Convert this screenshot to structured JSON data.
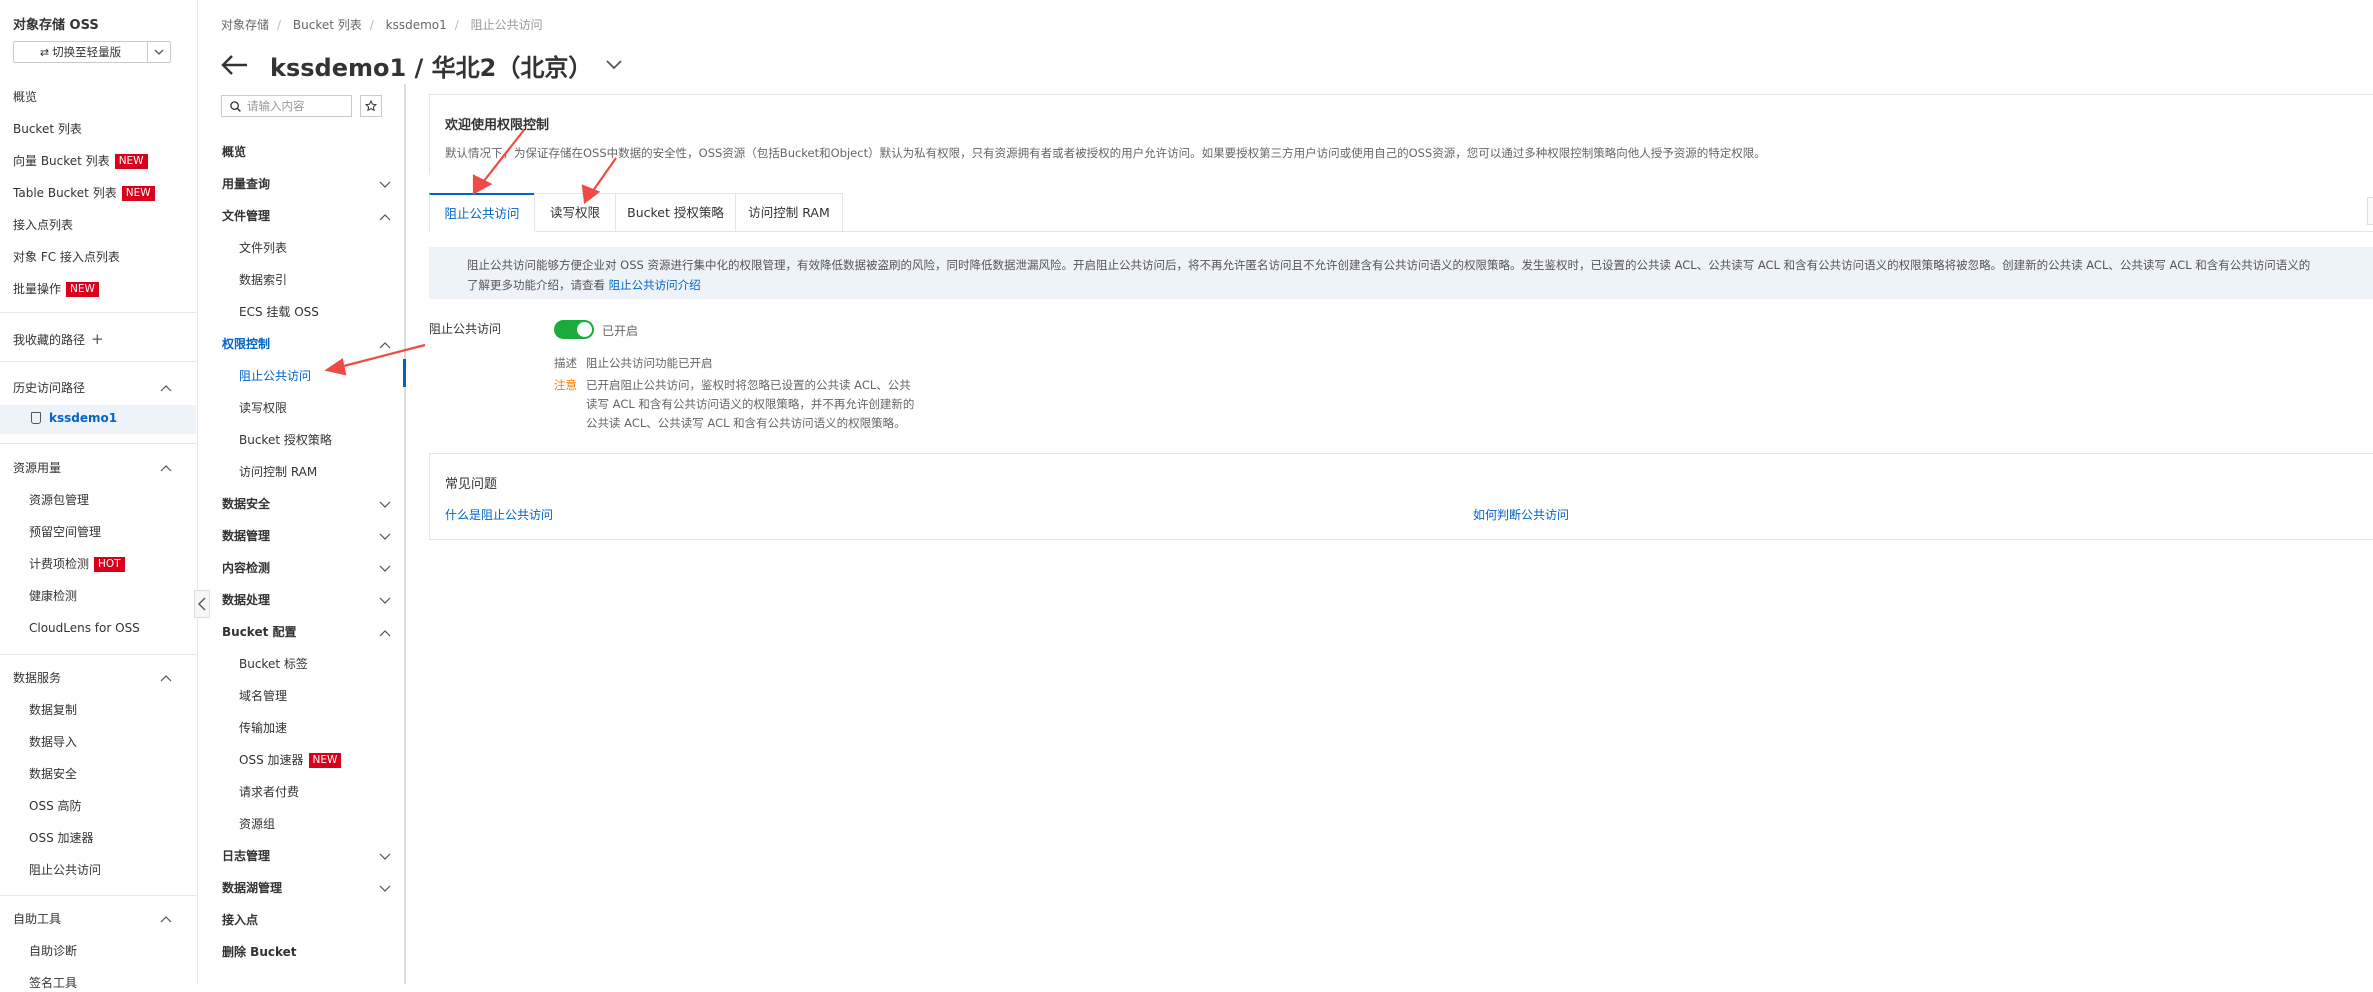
{
  "sidebar": {
    "brand": "对象存储 OSS",
    "switch_label": "切换至轻量版",
    "items": [
      {
        "label": "概览"
      },
      {
        "label": "Bucket 列表"
      },
      {
        "label": "向量 Bucket 列表",
        "badge": "NEW"
      },
      {
        "label": "Table Bucket 列表",
        "badge": "NEW"
      },
      {
        "label": "接入点列表"
      },
      {
        "label": "对象 FC 接入点列表"
      },
      {
        "label": "批量操作",
        "badge": "NEW"
      }
    ],
    "favorites": "我收藏的路径",
    "history": {
      "title": "历史访问路径",
      "item": "kssdemo1"
    },
    "resource": {
      "title": "资源用量",
      "items": [
        {
          "label": "资源包管理"
        },
        {
          "label": "预留空间管理"
        },
        {
          "label": "计费项检测",
          "badge": "HOT"
        },
        {
          "label": "健康检测"
        },
        {
          "label": "CloudLens for OSS"
        }
      ]
    },
    "data_service": {
      "title": "数据服务",
      "items": [
        {
          "label": "数据复制"
        },
        {
          "label": "数据导入"
        },
        {
          "label": "数据安全"
        },
        {
          "label": "OSS 高防"
        },
        {
          "label": "OSS 加速器"
        },
        {
          "label": "阻止公共访问"
        }
      ]
    },
    "tools": {
      "title": "自助工具",
      "items": [
        {
          "label": "自助诊断"
        },
        {
          "label": "签名工具"
        }
      ]
    }
  },
  "breadcrumb": [
    "对象存储",
    "Bucket 列表",
    "kssdemo1",
    "阻止公共访问"
  ],
  "title": "kssdemo1 / 华北2（北京）",
  "secnav": {
    "search_placeholder": "请输入内容",
    "items": [
      {
        "label": "概览"
      },
      {
        "label": "用量查询"
      },
      {
        "label": "文件管理"
      },
      {
        "label": "文件列表"
      },
      {
        "label": "数据索引"
      },
      {
        "label": "ECS 挂载 OSS"
      },
      {
        "label": "权限控制"
      },
      {
        "label": "阻止公共访问"
      },
      {
        "label": "读写权限"
      },
      {
        "label": "Bucket 授权策略"
      },
      {
        "label": "访问控制 RAM"
      },
      {
        "label": "数据安全"
      },
      {
        "label": "数据管理"
      },
      {
        "label": "内容检测"
      },
      {
        "label": "数据处理"
      },
      {
        "label": "Bucket 配置"
      },
      {
        "label": "Bucket 标签"
      },
      {
        "label": "域名管理"
      },
      {
        "label": "传输加速"
      },
      {
        "label": "OSS 加速器",
        "badge": "NEW"
      },
      {
        "label": "请求者付费"
      },
      {
        "label": "资源组"
      },
      {
        "label": "日志管理"
      },
      {
        "label": "数据湖管理"
      },
      {
        "label": "接入点"
      },
      {
        "label": "删除 Bucket"
      }
    ]
  },
  "welcome": {
    "title": "欢迎使用权限控制",
    "text": "默认情况下，为保证存储在OSS中数据的安全性，OSS资源（包括Bucket和Object）默认为私有权限，只有资源拥有者或者被授权的用户允许访问。如果要授权第三方用户访问或使用自己的OSS资源，您可以通过多种权限控制策略向他人授予资源的特定权限。"
  },
  "tabs": [
    "阻止公共访问",
    "读写权限",
    "Bucket 授权策略",
    "访问控制 RAM"
  ],
  "info": {
    "line1": "阻止公共访问能够方便企业对 OSS 资源进行集中化的权限管理，有效降低数据被盗刷的风险，同时降低数据泄漏风险。开启阻止公共访问后，将不再允许匿名访问且不允许创建含有公共访问语义的权限策略。发生鉴权时，已设置的公共读 ACL、公共读写 ACL 和含有公共访问语义的权限策略将被忽略。创建新的公共读 ACL、公共读写 ACL 和含有公共访问语义的",
    "line2_prefix": "了解更多功能介绍，请查看",
    "line2_link": "阻止公共访问介绍"
  },
  "setting": {
    "label": "阻止公共访问",
    "state": "已开启",
    "desc_key": "描述",
    "desc_val": "阻止公共访问功能已开启",
    "note_key": "注意",
    "note_lines": [
      "已开启阻止公共访问，鉴权时将忽略已设置的公共读 ACL、公共",
      "读写 ACL 和含有公共访问语义的权限策略，并不再允许创建新的",
      "公共读 ACL、公共读写 ACL 和含有公共访问语义的权限策略。"
    ]
  },
  "faq": {
    "title": "常见问题",
    "links": [
      "什么是阻止公共访问",
      "如何判断公共访问"
    ]
  },
  "colors": {
    "accent": "#0064c8",
    "toggle_on": "#1bab3c",
    "badge": "#d9001b",
    "annotation": "#f04a46"
  }
}
